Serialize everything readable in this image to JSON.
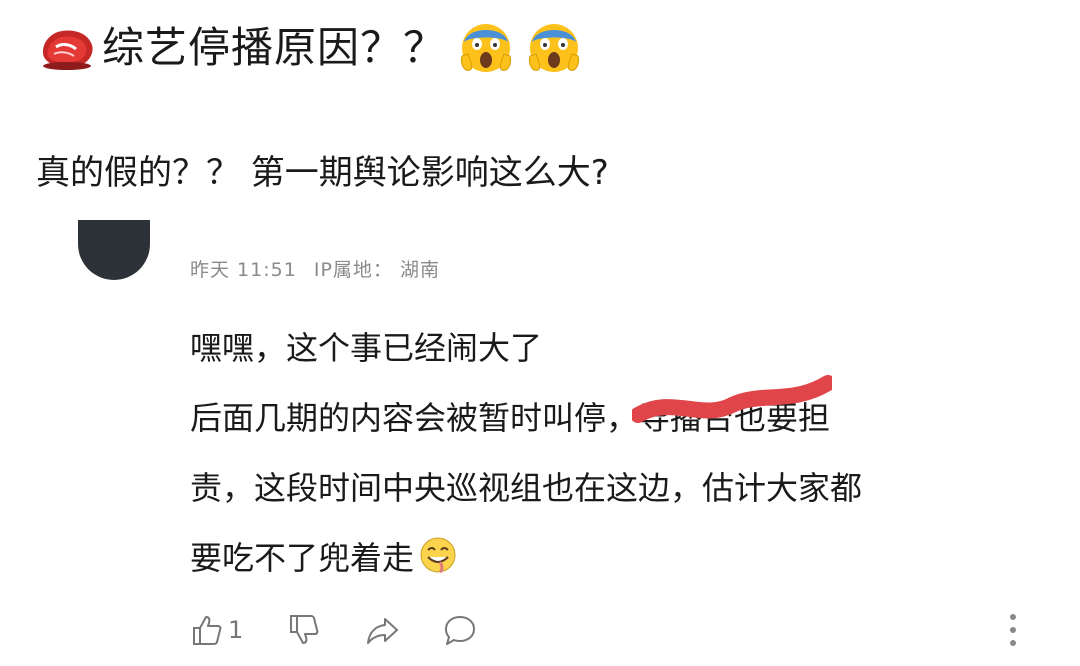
{
  "post": {
    "title": "综艺停播原因？？",
    "question": "真的假的？？ 第一期舆论影响这么大?"
  },
  "comment": {
    "meta": {
      "time": "昨天 11:51",
      "ip_location": "IP属地： 湖南"
    },
    "lines": {
      "l1": "嘿嘿，这个事已经闹大了",
      "l2_before": "后面几期的内容会被暂时叫停，",
      "l2_struck": "导播台",
      "l2_after": "也要担",
      "l3": "责，这段时间中央巡视组也在这边，估计大家都",
      "l4": "要吃不了兜着走"
    },
    "strike_color": "#e0454a",
    "like_count": "1"
  },
  "icons": {
    "title_icon": "meat-icon",
    "title_emojis": [
      "scream-emoji",
      "scream-emoji"
    ],
    "comment_emoji": "drooling-smile-emoji",
    "actions": [
      "thumbs-up-icon",
      "thumbs-down-icon",
      "share-icon",
      "comment-icon",
      "more-icon"
    ]
  }
}
